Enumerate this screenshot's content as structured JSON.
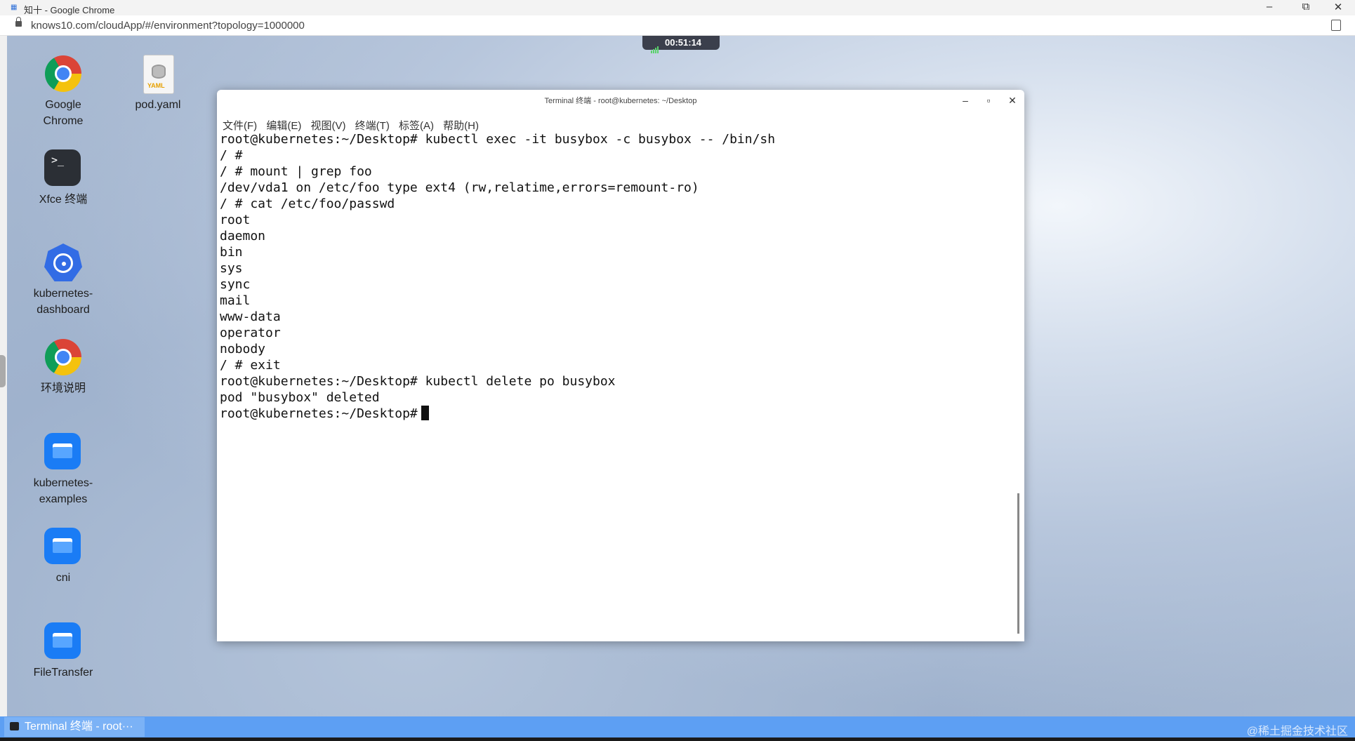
{
  "browser": {
    "tab_title": "知十 - Google Chrome",
    "url": "knows10.com/cloudApp/#/environment?topology=1000000",
    "controls": {
      "minimize": "–",
      "maximize": "⧉",
      "close": "✕"
    }
  },
  "session": {
    "timer": "00:51:14"
  },
  "desktop_icons": [
    {
      "label": "Google Chrome",
      "icon": "chrome-icon"
    },
    {
      "label": "pod.yaml",
      "icon": "yaml-file-icon"
    },
    {
      "label": "Xfce 终端",
      "icon": "terminal-icon"
    },
    {
      "label": "kubernetes-\ndashboard",
      "icon": "kubernetes-icon"
    },
    {
      "label": "环境说明",
      "icon": "chrome-icon"
    },
    {
      "label": "kubernetes-\nexamples",
      "icon": "folder-icon"
    },
    {
      "label": "cni",
      "icon": "folder-icon"
    },
    {
      "label": "FileTransfer",
      "icon": "folder-icon"
    }
  ],
  "terminal": {
    "title": "Terminal 终端 - root@kubernetes: ~/Desktop",
    "controls": {
      "minimize": "–",
      "maximize": "▫",
      "close": "✕"
    },
    "menu": [
      "文件(F)",
      "编辑(E)",
      "视图(V)",
      "终端(T)",
      "标签(A)",
      "帮助(H)"
    ],
    "lines": [
      "root@kubernetes:~/Desktop# kubectl exec -it busybox -c busybox -- /bin/sh",
      "/ #",
      "/ # mount | grep foo",
      "/dev/vda1 on /etc/foo type ext4 (rw,relatime,errors=remount-ro)",
      "/ # cat /etc/foo/passwd",
      "root",
      "daemon",
      "bin",
      "sys",
      "sync",
      "mail",
      "www-data",
      "operator",
      "nobody",
      "/ # exit",
      "root@kubernetes:~/Desktop# kubectl delete po busybox",
      "pod \"busybox\" deleted"
    ],
    "prompt": "root@kubernetes:~/Desktop#"
  },
  "taskbar": {
    "item_label": "Terminal 终端 - root···"
  },
  "watermark": "@稀土掘金技术社区"
}
